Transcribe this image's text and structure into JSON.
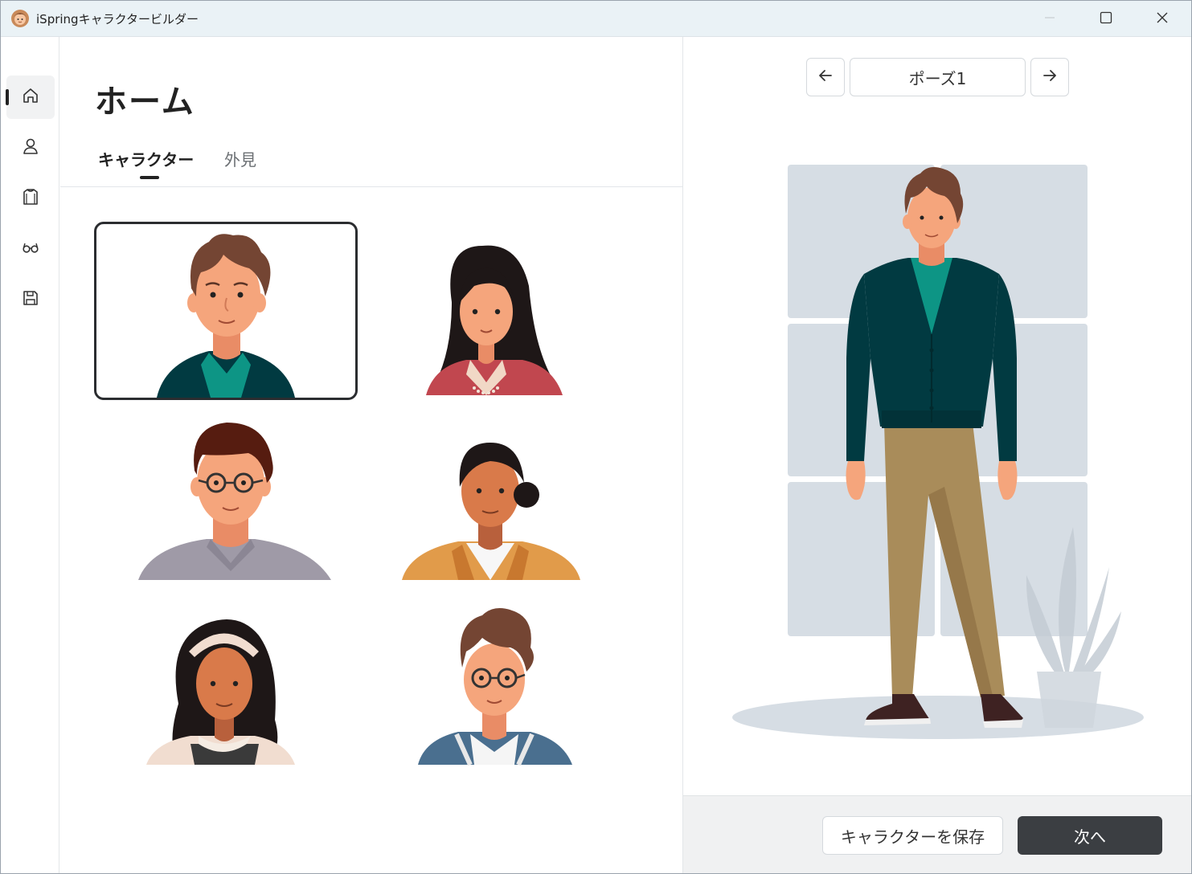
{
  "window": {
    "title": "iSpringキャラクタービルダー",
    "icons": {
      "app": "character-face-icon",
      "minimize": "minimize-icon",
      "maximize": "maximize-icon",
      "close": "close-icon"
    }
  },
  "sidebar": {
    "items": [
      {
        "name": "home",
        "icon": "home-icon",
        "active": true
      },
      {
        "name": "character",
        "icon": "person-icon",
        "active": false
      },
      {
        "name": "clothes",
        "icon": "shirt-icon",
        "active": false
      },
      {
        "name": "accessories",
        "icon": "glasses-icon",
        "active": false
      },
      {
        "name": "save",
        "icon": "floppy-disk-icon",
        "active": false
      }
    ]
  },
  "main": {
    "title": "ホーム",
    "tabs": [
      {
        "label": "キャラクター",
        "active": true
      },
      {
        "label": "外見",
        "active": false
      }
    ],
    "characters": [
      {
        "id": "man-curly-cardigan",
        "selected": true
      },
      {
        "id": "woman-long-black-hair",
        "selected": false
      },
      {
        "id": "man-glasses-grey-shirt",
        "selected": false
      },
      {
        "id": "woman-bun-yellow-jacket",
        "selected": false
      },
      {
        "id": "woman-headband-curly-hair",
        "selected": false
      },
      {
        "id": "boy-glasses-varsity-jacket",
        "selected": false
      }
    ]
  },
  "preview": {
    "pose_label": "ポーズ1",
    "icons": {
      "prev": "arrow-left-icon",
      "next": "arrow-right-icon"
    }
  },
  "footer": {
    "save_label": "キャラクターを保存",
    "next_label": "次へ"
  },
  "colors": {
    "accent_dark": "#3b3e42",
    "cardigan": "#013a41",
    "shirt_teal": "#0d9585",
    "pants_khaki": "#a98c5a",
    "skin": "#f5a57c",
    "hair_brown": "#744533",
    "window_panel": "#d6dde4"
  }
}
